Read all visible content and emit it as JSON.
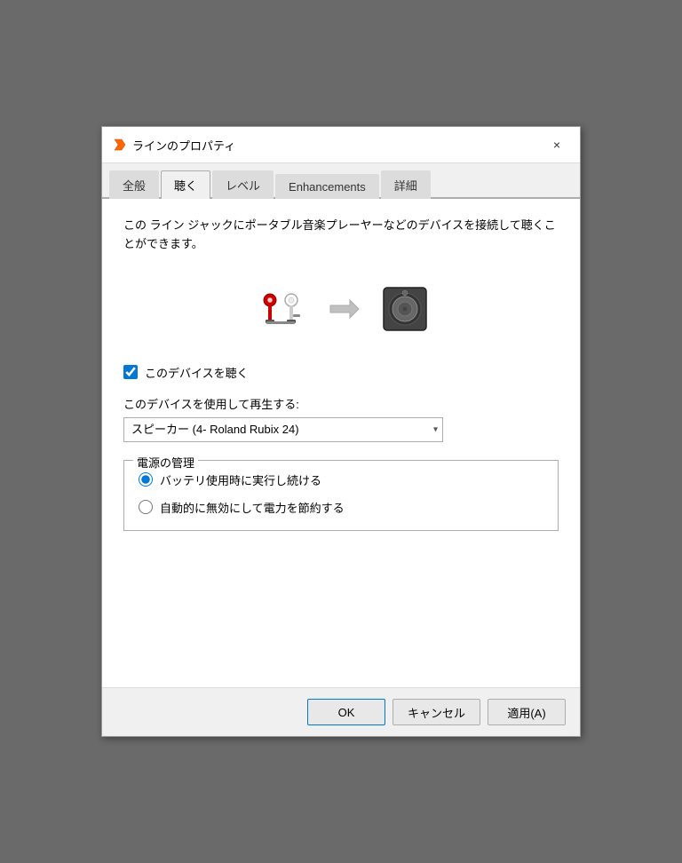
{
  "dialog": {
    "title": "ラインのプロパティ",
    "close_label": "×"
  },
  "tabs": [
    {
      "id": "general",
      "label": "全般",
      "active": false
    },
    {
      "id": "listen",
      "label": "聴く",
      "active": true
    },
    {
      "id": "level",
      "label": "レベル",
      "active": false
    },
    {
      "id": "enhancements",
      "label": "Enhancements",
      "active": false
    },
    {
      "id": "details",
      "label": "詳細",
      "active": false
    }
  ],
  "body": {
    "description": "この ライン ジャックにポータブル音楽プレーヤーなどのデバイスを接続して聴くことができます。",
    "checkbox_label": "このデバイスを聴く",
    "checkbox_checked": true,
    "playback_label": "このデバイスを使用して再生する:",
    "dropdown_value": "スピーカー (4- Roland Rubix 24)",
    "dropdown_options": [
      "スピーカー (4- Roland Rubix 24)"
    ],
    "power_group_label": "電源の管理",
    "radio_options": [
      {
        "id": "battery",
        "label": "バッテリ使用時に実行し続ける",
        "checked": true
      },
      {
        "id": "auto",
        "label": "自動的に無効にして電力を節約する",
        "checked": false
      }
    ]
  },
  "footer": {
    "ok_label": "OK",
    "cancel_label": "キャンセル",
    "apply_label": "適用(A)"
  },
  "icons": {
    "title_icon": "🔊",
    "cable": "cable-icon",
    "arrow": "➨",
    "speaker": "speaker-icon"
  }
}
